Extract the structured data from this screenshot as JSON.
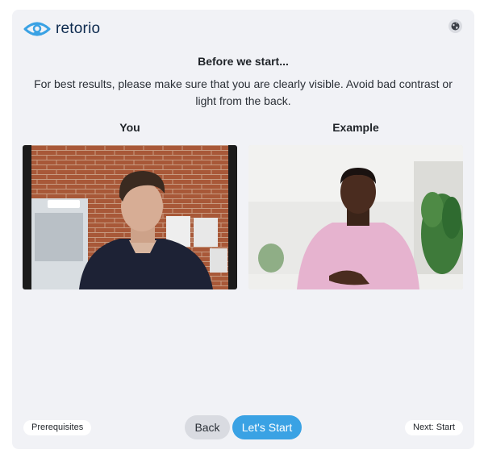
{
  "brand": {
    "name": "retorio",
    "color": "#3aa2e4",
    "icon": "eye-icon"
  },
  "header": {
    "language_icon": "globe-icon"
  },
  "intro": {
    "title": "Before we start...",
    "description": "For best results, please make sure that you are clearly visible. Avoid bad contrast or light from the back."
  },
  "columns": {
    "you": {
      "label": "You"
    },
    "example": {
      "label": "Example"
    }
  },
  "footer": {
    "prerequisites_label": "Prerequisites",
    "back_label": "Back",
    "start_label": "Let's Start",
    "next_label": "Next: Start",
    "start_color": "#3aa2e4"
  }
}
